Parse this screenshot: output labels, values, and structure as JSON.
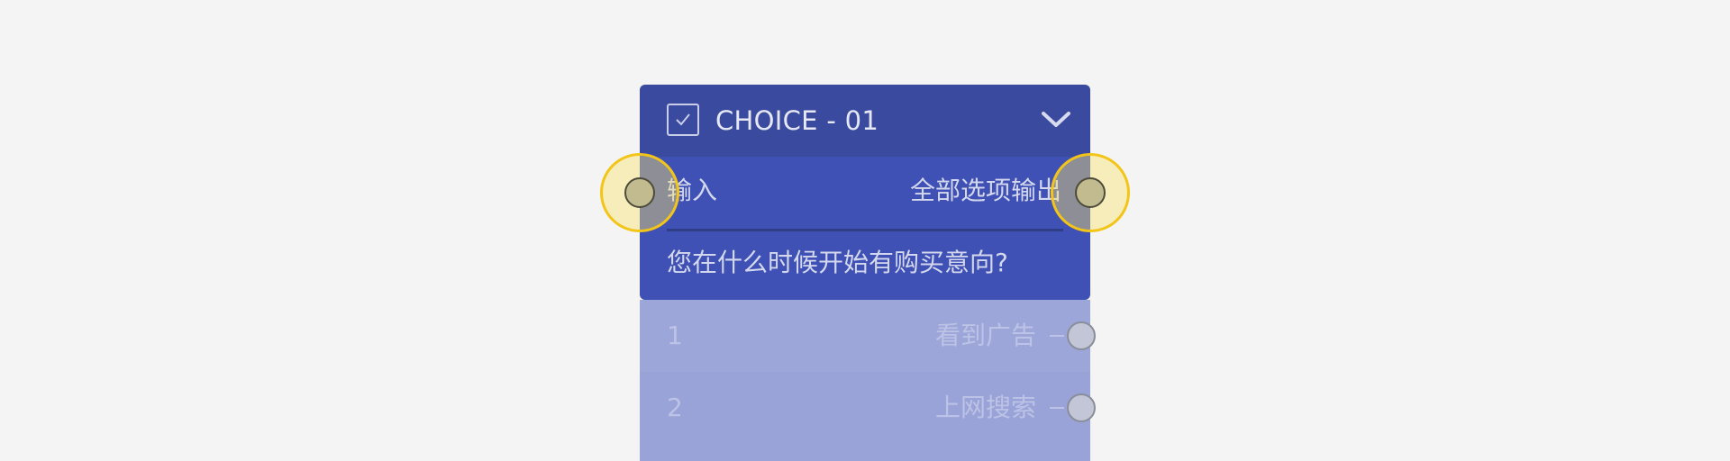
{
  "node": {
    "title": "CHOICE - 01",
    "input_label": "输入",
    "output_label": "全部选项输出",
    "question": "您在什么时候开始有购买意向?",
    "options": [
      {
        "index": "1",
        "label": "看到广告"
      },
      {
        "index": "2",
        "label": "上网搜索"
      }
    ]
  },
  "icons": {
    "header": "checkbox-checked-icon",
    "collapse": "chevron-down-icon"
  },
  "colors": {
    "background": "#f4f4f4",
    "header": "#3a4a9f",
    "body": "#3f51b5",
    "options": "#9ca6d8",
    "port_highlight": "#f3c519",
    "port_fill": "#c2bb8f"
  }
}
